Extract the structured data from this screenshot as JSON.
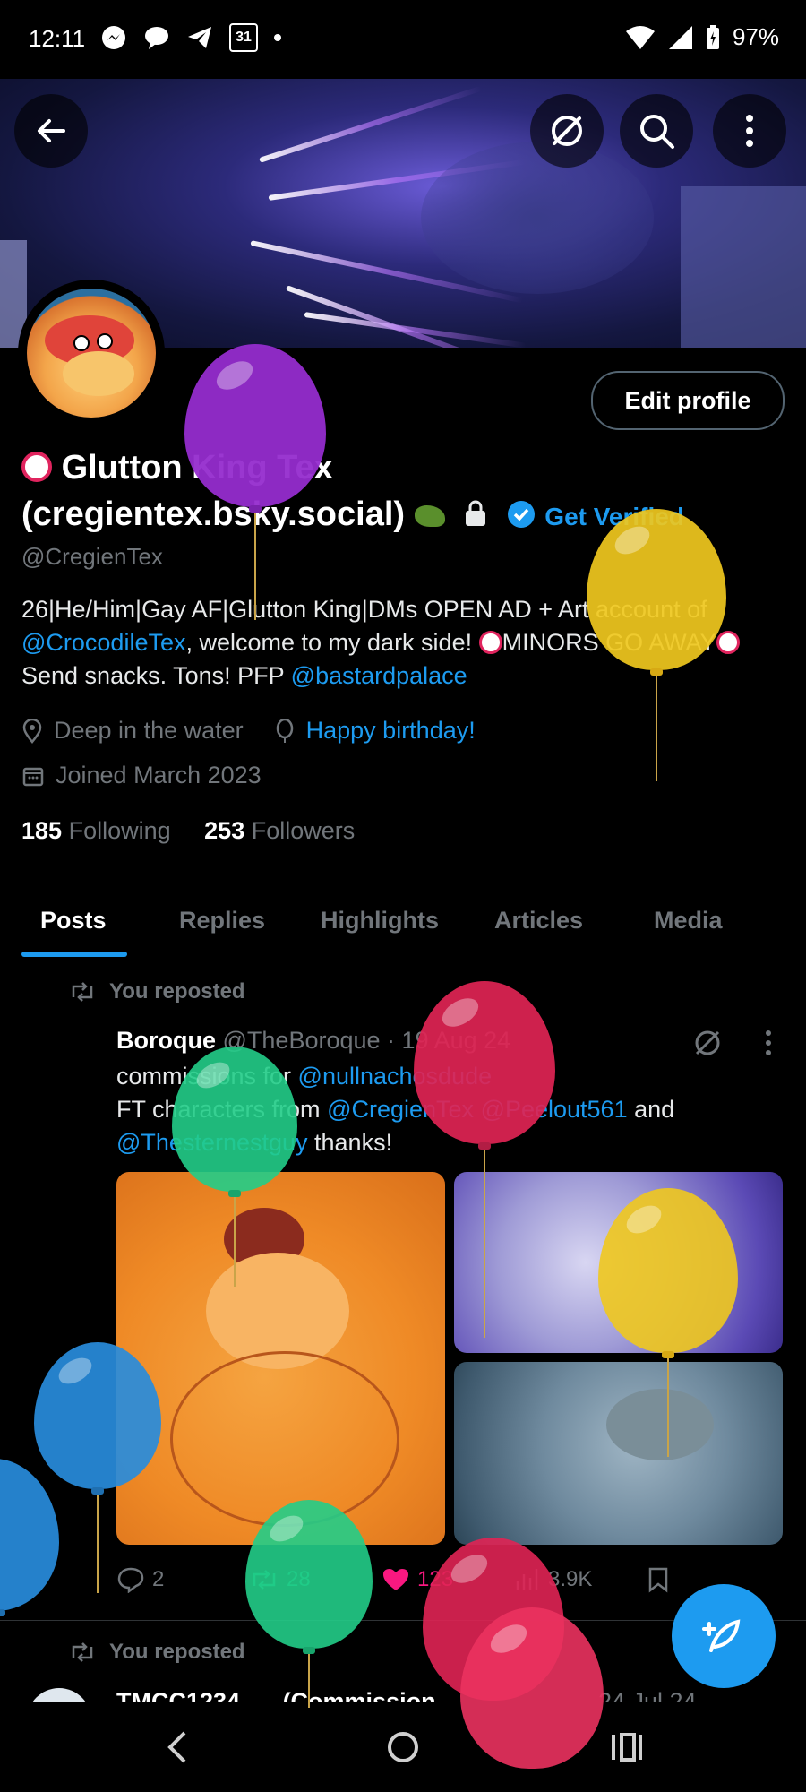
{
  "status_bar": {
    "time": "12:11",
    "calendar_day": "31",
    "battery": "97%"
  },
  "header": {
    "back_icon": "arrow-left-icon",
    "actions": [
      "no-eye-icon",
      "search-icon",
      "more-vertical-icon"
    ]
  },
  "profile": {
    "name_line1": "Glutton King Tex",
    "name_line2": "(cregientex.bsky.social)",
    "get_verified": "Get Verified",
    "handle": "@CregienTex",
    "edit_button": "Edit profile",
    "bio": {
      "part1": "26|He/Him|Gay AF|Glutton King|DMs OPEN  AD + Art account of ",
      "mention1": "@CrocodileTex",
      "part2": ", welcome to my dark side! ",
      "part3": "MINORS GO AWAY",
      "part4": " Send snacks. Tons!   PFP ",
      "mention2": "@bastardpalace"
    },
    "location": "Deep in the water",
    "birthday": "Happy birthday!",
    "joined": "Joined March 2023",
    "following_count": "185",
    "following_label": "Following",
    "followers_count": "253",
    "followers_label": "Followers"
  },
  "tabs": [
    "Posts",
    "Replies",
    "Highlights",
    "Articles",
    "Media"
  ],
  "active_tab": "Posts",
  "post": {
    "repost_label": "You reposted",
    "author_name": "Boroque",
    "author_handle": "@TheBoroque",
    "date": "19 Aug 24",
    "line1_text": "commissions for ",
    "line1_mention": "@nullnachosdude",
    "line2_text": "FT characters from ",
    "line2_mention1": "@CregienTex",
    "line2_mention2": "@Peelout561",
    "line2_and": " and",
    "line3_mention": "@Thesternestguy",
    "line3_text": " thanks!",
    "replies": "2",
    "reposts": "28",
    "likes": "123",
    "views": "3.9K"
  },
  "post2": {
    "repost_label": "You reposted",
    "author_partial": "TMCC1234",
    "name_partial": "(Commission",
    "date_partial": "24 Jul 24"
  },
  "colors": {
    "accent": "#1d9bf0",
    "like": "#f91880",
    "repost": "#00ba7c"
  }
}
